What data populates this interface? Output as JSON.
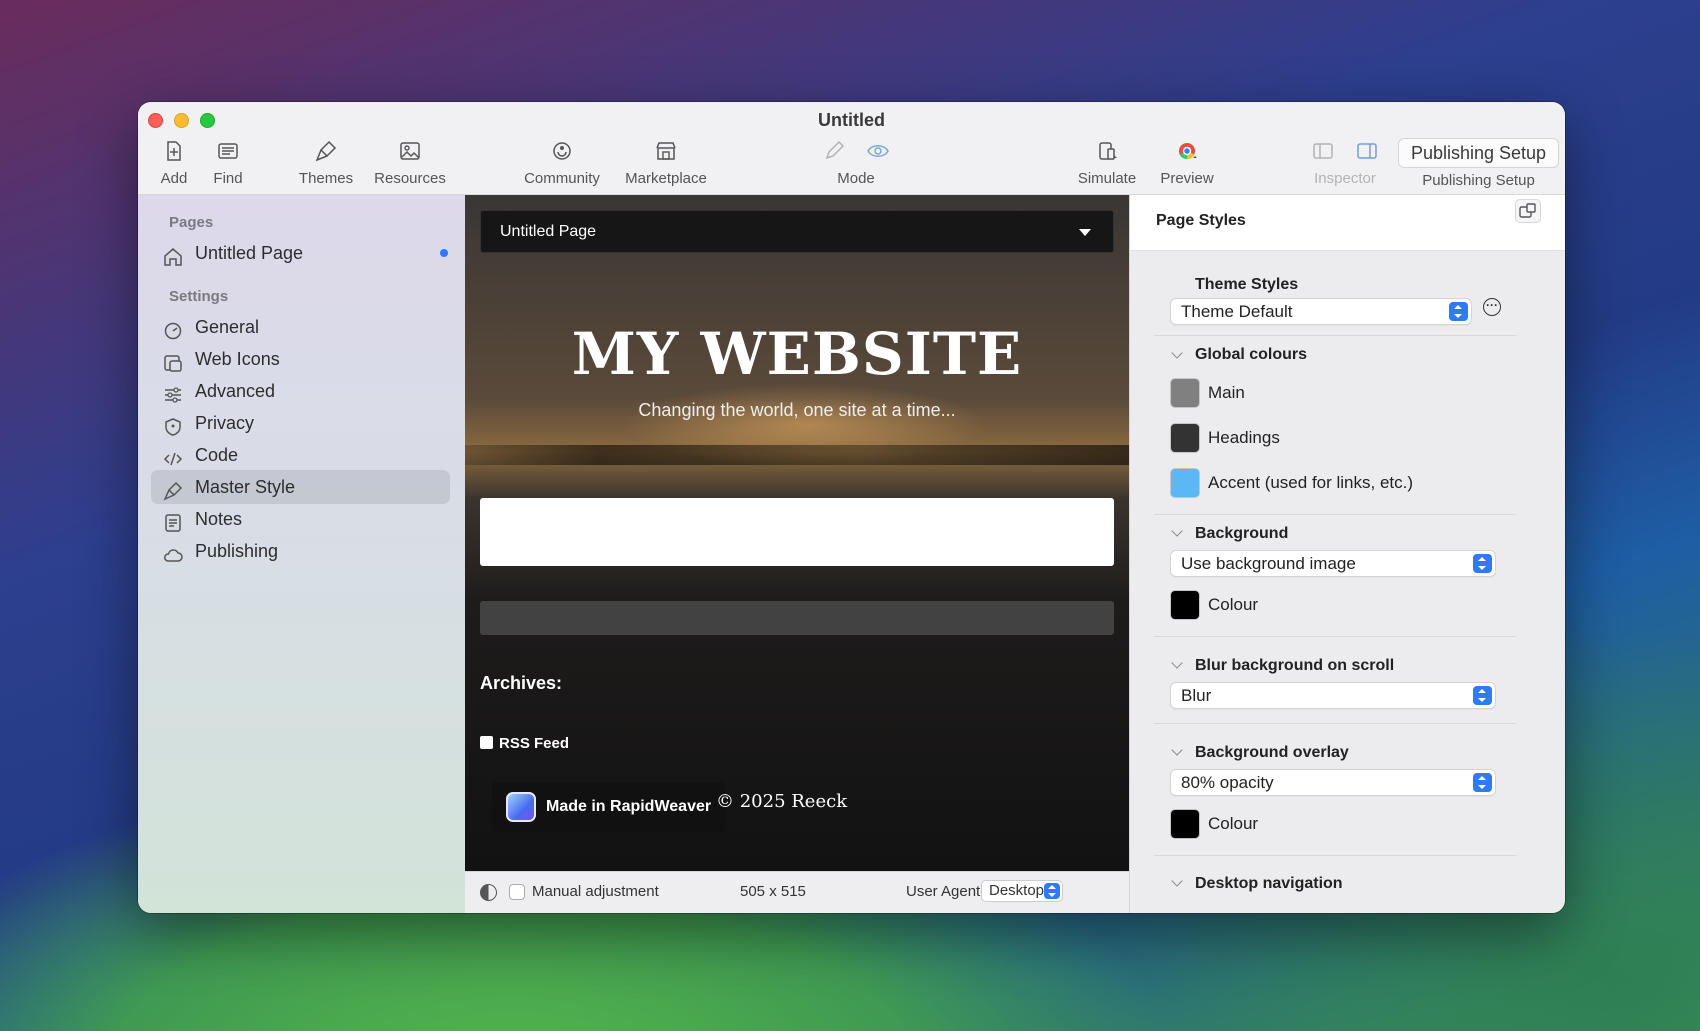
{
  "window": {
    "title": "Untitled"
  },
  "toolbar": {
    "add": "Add",
    "find": "Find",
    "themes": "Themes",
    "resources": "Resources",
    "community": "Community",
    "marketplace": "Marketplace",
    "mode": "Mode",
    "simulate": "Simulate",
    "preview": "Preview",
    "inspector": "Inspector",
    "publishing_setup_button": "Publishing Setup",
    "publishing_setup_label": "Publishing Setup"
  },
  "sidebar": {
    "pages_header": "Pages",
    "pages": [
      {
        "label": "Untitled Page",
        "icon": "house-icon",
        "modified_dot": true
      }
    ],
    "settings_header": "Settings",
    "settings": [
      {
        "label": "General",
        "icon": "gauge-icon"
      },
      {
        "label": "Web Icons",
        "icon": "web-icons-icon"
      },
      {
        "label": "Advanced",
        "icon": "sliders-icon"
      },
      {
        "label": "Privacy",
        "icon": "shield-icon"
      },
      {
        "label": "Code",
        "icon": "code-icon"
      },
      {
        "label": "Master Style",
        "icon": "brush-icon",
        "selected": true
      },
      {
        "label": "Notes",
        "icon": "notes-icon"
      },
      {
        "label": "Publishing",
        "icon": "cloud-icon"
      }
    ]
  },
  "preview": {
    "nav_label": "Untitled Page",
    "site_title": "MY WEBSITE",
    "site_subtitle": "Changing the world, one site at a time...",
    "archives_label": "Archives:",
    "rss_label": "RSS Feed",
    "made_in": "Made in RapidWeaver",
    "copyright": "© 2025 Reeck",
    "footer": {
      "manual_adjustment": "Manual adjustment",
      "manual_checked": false,
      "size": "505 x 515",
      "user_agent_label": "User Agent",
      "user_agent_value": "Desktop"
    }
  },
  "inspector": {
    "title": "Page Styles",
    "theme_styles_label": "Theme Styles",
    "theme_styles_value": "Theme Default",
    "global_colours_label": "Global colours",
    "colours": [
      {
        "label": "Main",
        "color": "#808080"
      },
      {
        "label": "Headings",
        "color": "#333333"
      },
      {
        "label": "Accent (used for links, etc.)",
        "color": "#5bb8f5"
      }
    ],
    "background_label": "Background",
    "background_value": "Use background image",
    "background_colour_label": "Colour",
    "background_colour": "#000000",
    "blur_label": "Blur background on scroll",
    "blur_value": "Blur",
    "overlay_label": "Background overlay",
    "overlay_value": "80% opacity",
    "overlay_colour_label": "Colour",
    "overlay_colour": "#000000",
    "desktop_nav_label": "Desktop navigation"
  }
}
